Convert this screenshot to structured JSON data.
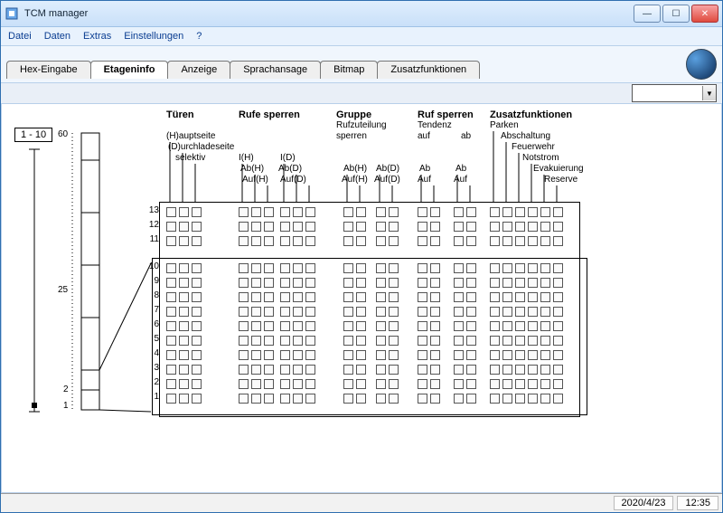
{
  "window": {
    "title": "TCM manager"
  },
  "menu": {
    "datei": "Datei",
    "daten": "Daten",
    "extras": "Extras",
    "einstellungen": "Einstellungen",
    "help": "?"
  },
  "tabs": {
    "hex": "Hex-Eingabe",
    "etagen": "Etageninfo",
    "anzeige": "Anzeige",
    "sprach": "Sprachansage",
    "bitmap": "Bitmap",
    "zusatz": "Zusatzfunktionen"
  },
  "range": "1 - 10",
  "headers": {
    "tueren": "Türen",
    "rufe": "Rufe sperren",
    "gruppe": "Gruppe",
    "gruppe2": "Rufzuteilung",
    "gruppe3": "sperren",
    "rufsp": "Ruf sperren",
    "tendenz": "Tendenz",
    "auf": "auf",
    "ab": "ab",
    "zusatz": "Zusatzfunktionen",
    "parken": "Parken",
    "absch": "Abschaltung",
    "feuer": "Feuerwehr",
    "not": "Notstrom",
    "evak": "Evakuierung",
    "res": "Reserve",
    "haupt": "(H)auptseite",
    "durch": "(D)urchladeseite",
    "selektiv": "selektiv",
    "IH": "I(H)",
    "ID": "I(D)",
    "AbH": "Ab(H)",
    "AbD": "Ab(D)",
    "AufH": "Auf(H)",
    "AufD": "Auf(D)",
    "AbH2": "Ab(H)",
    "AbD2": "Ab(D)",
    "AufH2": "Auf(H)",
    "AufD2": "Auf(D)",
    "Ab": "Ab",
    "Auf": "Auf",
    "Ab2": "Ab",
    "Auf2": "Auf"
  },
  "ruler": {
    "top": "60",
    "mid": "25",
    "low": "2",
    "bot": "1"
  },
  "rows_top": [
    "13",
    "12",
    "11"
  ],
  "rows_main": [
    "10",
    "9",
    "8",
    "7",
    "6",
    "5",
    "4",
    "3",
    "2",
    "1"
  ],
  "status": {
    "date": "2020/4/23",
    "time": "12:35"
  }
}
